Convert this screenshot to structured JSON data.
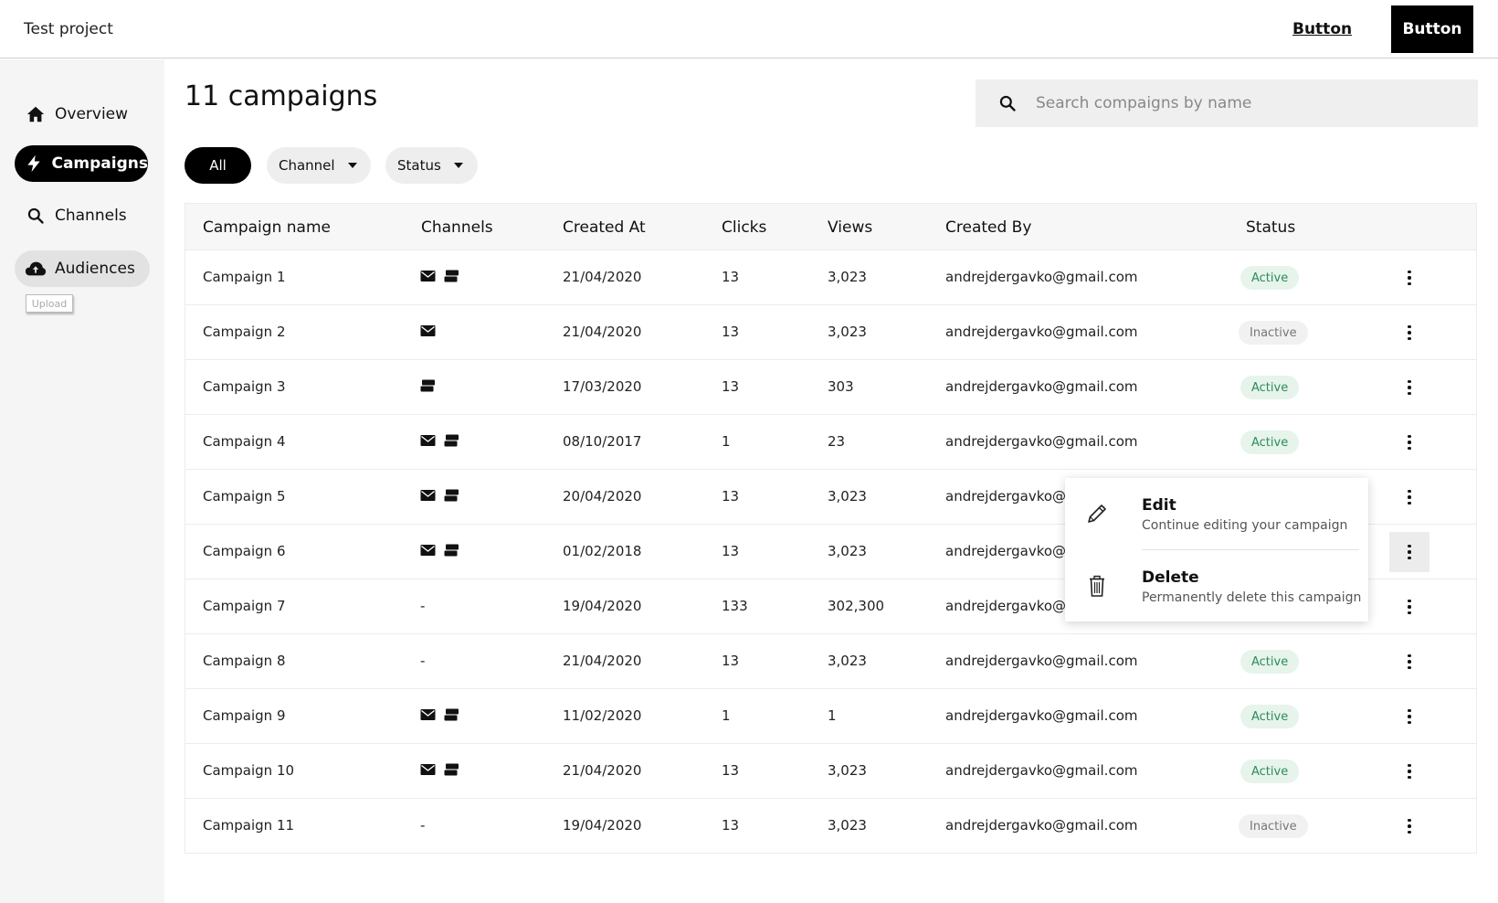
{
  "header": {
    "project_title": "Test project",
    "link_button": "Button",
    "primary_button": "Button"
  },
  "sidebar": {
    "items": [
      {
        "label": "Overview",
        "icon": "home-icon"
      },
      {
        "label": "Campaigns",
        "icon": "lightning-icon",
        "state": "active"
      },
      {
        "label": "Channels",
        "icon": "search-icon"
      },
      {
        "label": "Audiences",
        "icon": "cloud-upload-icon",
        "state": "hover"
      }
    ],
    "tooltip": "Upload"
  },
  "main": {
    "title": "11 campaigns",
    "search_placeholder": "Search compaigns by name",
    "filters": {
      "all": "All",
      "channel": "Channel",
      "status": "Status"
    }
  },
  "table": {
    "columns": [
      "Campaign name",
      "Channels",
      "Created At",
      "Clicks",
      "Views",
      "Created By",
      "Status"
    ],
    "rows": [
      {
        "name": "Campaign 1",
        "channels": [
          "email",
          "sms"
        ],
        "created_at": "21/04/2020",
        "clicks": "13",
        "views": "3,023",
        "created_by": "andrejdergavko@gmail.com",
        "status": "Active"
      },
      {
        "name": "Campaign 2",
        "channels": [
          "email"
        ],
        "created_at": "21/04/2020",
        "clicks": "13",
        "views": "3,023",
        "created_by": "andrejdergavko@gmail.com",
        "status": "Inactive"
      },
      {
        "name": "Campaign 3",
        "channels": [
          "sms"
        ],
        "created_at": "17/03/2020",
        "clicks": "13",
        "views": "303",
        "created_by": "andrejdergavko@gmail.com",
        "status": "Active"
      },
      {
        "name": "Campaign 4",
        "channels": [
          "email",
          "sms"
        ],
        "created_at": "08/10/2017",
        "clicks": "1",
        "views": "23",
        "created_by": "andrejdergavko@gmail.com",
        "status": "Active"
      },
      {
        "name": "Campaign 5",
        "channels": [
          "email",
          "sms"
        ],
        "created_at": "20/04/2020",
        "clicks": "13",
        "views": "3,023",
        "created_by": "andrejdergavko@gi",
        "status": ""
      },
      {
        "name": "Campaign 6",
        "channels": [
          "email",
          "sms"
        ],
        "created_at": "01/02/2018",
        "clicks": "13",
        "views": "3,023",
        "created_by": "andrejdergavko@gi",
        "status": ""
      },
      {
        "name": "Campaign 7",
        "channels": [],
        "channels_text": "-",
        "created_at": "19/04/2020",
        "clicks": "133",
        "views": "302,300",
        "created_by": "andrejdergavko@gi",
        "status": ""
      },
      {
        "name": "Campaign 8",
        "channels": [],
        "channels_text": "-",
        "created_at": "21/04/2020",
        "clicks": "13",
        "views": "3,023",
        "created_by": "andrejdergavko@gmail.com",
        "status": "Active"
      },
      {
        "name": "Campaign 9",
        "channels": [
          "email",
          "sms"
        ],
        "created_at": "11/02/2020",
        "clicks": "1",
        "views": "1",
        "created_by": "andrejdergavko@gmail.com",
        "status": "Active"
      },
      {
        "name": "Campaign 10",
        "channels": [
          "email",
          "sms"
        ],
        "created_at": "21/04/2020",
        "clicks": "13",
        "views": "3,023",
        "created_by": "andrejdergavko@gmail.com",
        "status": "Active"
      },
      {
        "name": "Campaign 11",
        "channels": [],
        "channels_text": "-",
        "created_at": "19/04/2020",
        "clicks": "13",
        "views": "3,023",
        "created_by": "andrejdergavko@gmail.com",
        "status": "Inactive"
      }
    ],
    "open_menu_row": 6
  },
  "context_menu": {
    "items": [
      {
        "title": "Edit",
        "description": "Continue editing your campaign",
        "icon": "pencil-icon"
      },
      {
        "title": "Delete",
        "description": "Permanently delete this campaign",
        "icon": "trash-icon"
      }
    ]
  },
  "colors": {
    "primary": "#000000",
    "active_badge_bg": "#e6f4ec",
    "active_badge_text": "#2e8b57",
    "inactive_badge_bg": "#f1f1f1",
    "inactive_badge_text": "#777777"
  }
}
